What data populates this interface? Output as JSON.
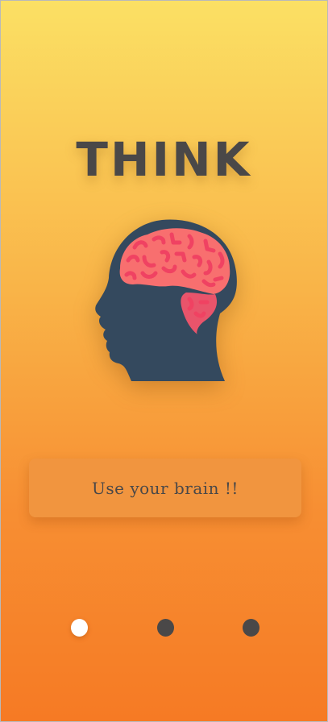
{
  "screen": {
    "title": "THINK",
    "illustration_icon": "brain-head-icon",
    "message": "Use your brain !!"
  },
  "pager": {
    "total_pages": 3,
    "active_index": 0
  },
  "colors": {
    "gradient_top": "#fbe064",
    "gradient_bottom": "#f67a24",
    "text_dark": "#4a4848",
    "card": "#f1953f",
    "head": "#34495e",
    "brain": "#f86f6f",
    "brain_detail": "#f04262",
    "dot_active": "#ffffff",
    "dot_inactive": "#4a4848"
  }
}
